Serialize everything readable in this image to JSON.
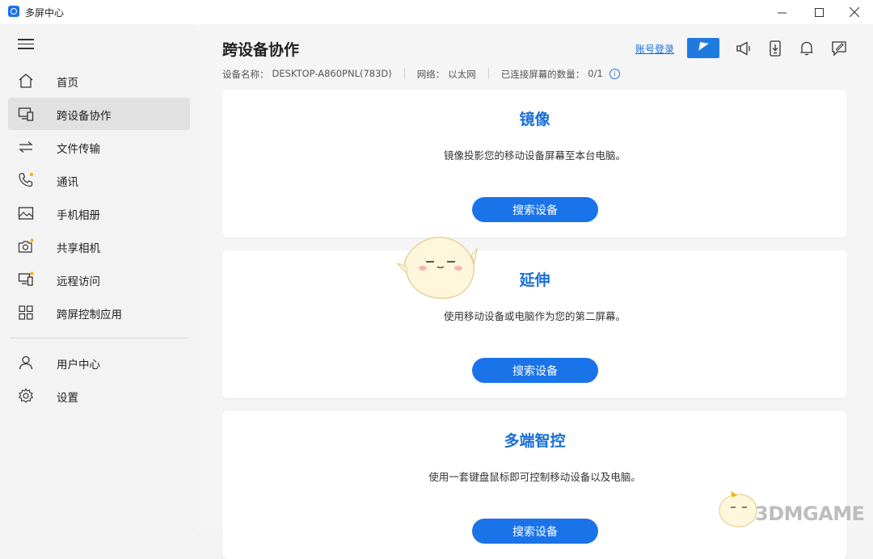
{
  "window": {
    "title": "多屏中心",
    "minimize": "–",
    "maximize": "☐",
    "close": "✕"
  },
  "sidebar": {
    "items": [
      {
        "label": "首页",
        "icon": "home-icon"
      },
      {
        "label": "跨设备协作",
        "icon": "cross-device-icon",
        "active": true
      },
      {
        "label": "文件传输",
        "icon": "transfer-icon"
      },
      {
        "label": "通讯",
        "icon": "phone-icon"
      },
      {
        "label": "手机相册",
        "icon": "photo-icon"
      },
      {
        "label": "共享相机",
        "icon": "camera-icon"
      },
      {
        "label": "远程访问",
        "icon": "remote-icon"
      },
      {
        "label": "跨屏控制应用",
        "icon": "apps-grid-icon"
      }
    ],
    "bottom_items": [
      {
        "label": "用户中心",
        "icon": "user-icon"
      },
      {
        "label": "设置",
        "icon": "gear-icon"
      }
    ]
  },
  "header": {
    "title": "跨设备协作",
    "login_link": "账号登录",
    "device_label": "设备名称：",
    "device_name": "DESKTOP-A860PNL(783D)",
    "network_label": "网络：",
    "network_value": "以太网",
    "screens_label": "已连接屏幕的数量：",
    "screens_value": "0/1",
    "info_glyph": "i"
  },
  "cards": [
    {
      "title": "镜像",
      "description": "镜像投影您的移动设备屏幕至本台电脑。",
      "button": "搜索设备"
    },
    {
      "title": "延伸",
      "description": "使用移动设备或电脑作为您的第二屏幕。",
      "button": "搜索设备"
    },
    {
      "title": "多端智控",
      "description": "使用一套键盘鼠标即可控制移动设备以及电脑。",
      "button": "搜索设备"
    }
  ],
  "watermark": {
    "text": "3DMGAME"
  },
  "colors": {
    "accent": "#1a73e8",
    "link": "#1a6fd6",
    "badge_star": "#f0b400"
  }
}
